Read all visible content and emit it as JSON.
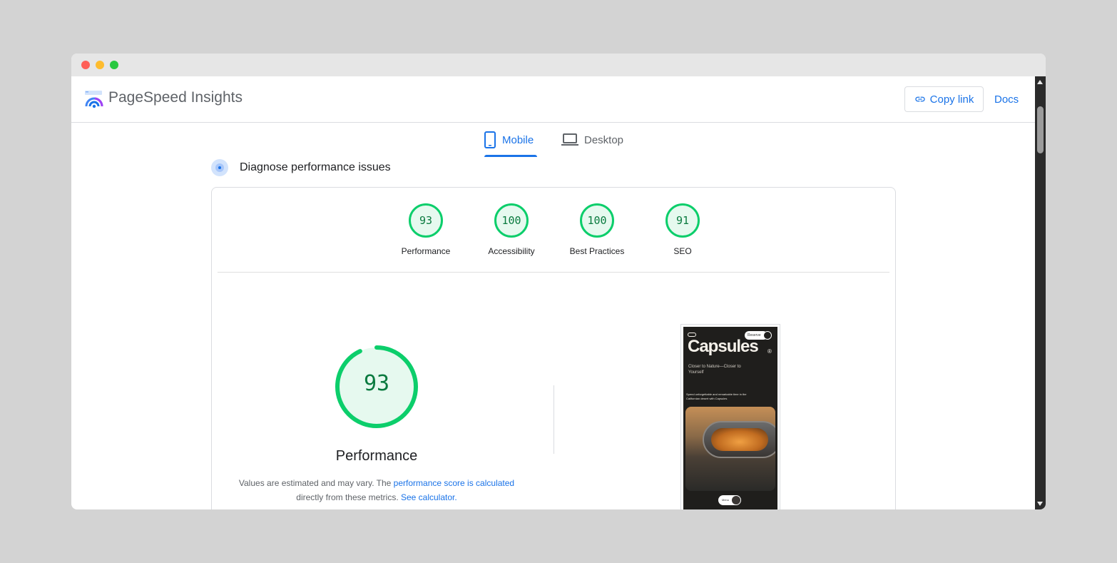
{
  "app": {
    "title": "PageSpeed Insights",
    "logo_icon": "pagespeed-logo-icon"
  },
  "header": {
    "copy_link_label": "Copy link",
    "copy_link_icon": "link-icon",
    "docs_label": "Docs"
  },
  "tabs": [
    {
      "label": "Mobile",
      "icon": "mobile-phone-icon",
      "active": true
    },
    {
      "label": "Desktop",
      "icon": "laptop-icon",
      "active": false
    }
  ],
  "diagnose": {
    "title": "Diagnose performance issues",
    "icon": "diagnose-icon"
  },
  "scores": [
    {
      "value": "93",
      "label": "Performance"
    },
    {
      "value": "100",
      "label": "Accessibility"
    },
    {
      "value": "100",
      "label": "Best Practices"
    },
    {
      "value": "91",
      "label": "SEO"
    }
  ],
  "main_score": {
    "value": "93",
    "fraction": 0.93,
    "label": "Performance",
    "note_prefix": "Values are estimated and may vary. The ",
    "note_link1": "performance score is calculated",
    "note_middle": " directly from these metrics. ",
    "note_link2": "See calculator."
  },
  "screenshot": {
    "brand": "Capsules",
    "registered": "®",
    "pill_label": "Reserve",
    "tagline": "Closer to Nature—Closer to Yourself",
    "subtitle": "Spend unforgettable and remarkable time in the Californian desert with Capsules",
    "toggle_label": "Menu"
  },
  "colors": {
    "accent": "#1a73e8",
    "pass": "#0cce6b",
    "pass_text": "#0a7a3f",
    "pass_bg": "#e6f9ef"
  }
}
